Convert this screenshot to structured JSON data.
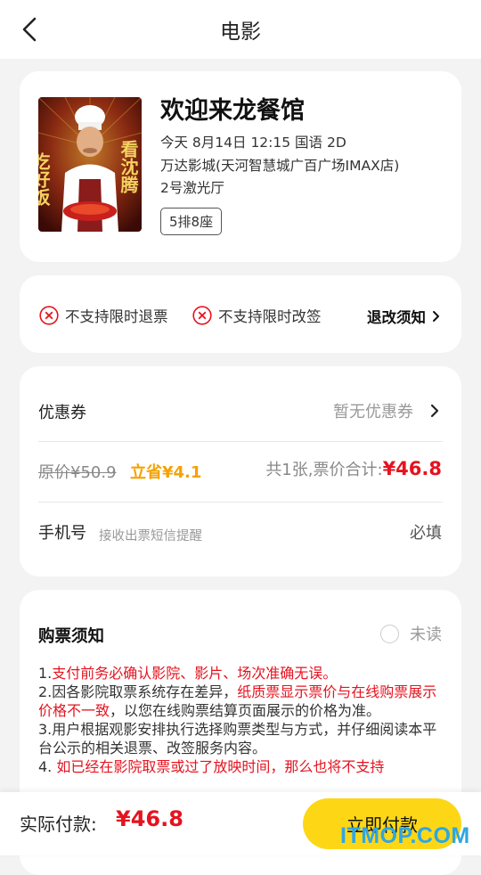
{
  "header": {
    "title": "电影"
  },
  "movie": {
    "title": "欢迎来龙餐馆",
    "showtime": "今天 8月14日 12:15 国语 2D",
    "cinema": "万达影城(天河智慧城广百广场IMAX店)",
    "hall": "2号激光厅",
    "seat": "5排8座",
    "poster_text_left": "吃好饭",
    "poster_text_right": "看沈腾"
  },
  "refund": {
    "no_refund": "不支持限时退票",
    "no_change": "不支持限时改签",
    "policy_link": "退改须知"
  },
  "payment": {
    "coupon_label": "优惠券",
    "coupon_value": "暂无优惠券",
    "original_price": "原价¥50.9",
    "saved": "立省¥4.1",
    "total_label": "共1张,票价合计:",
    "total_price": "¥46.8",
    "phone_label": "手机号",
    "phone_placeholder": "接收出票短信提醒",
    "required": "必填"
  },
  "notice": {
    "title": "购票须知",
    "unread": "未读",
    "p1_a": "1.",
    "p1_red": "支付前务必确认影院、影片、场次准确无误。",
    "p2_a": "2.因各影院取票系统存在差异，",
    "p2_red": "纸质票显示票价与在线购票展示价格不一致",
    "p2_b": "，以您在线购票结算页面展示的价格为准。",
    "p3": "3.用户根据观影安排执行选择购票类型与方式，并仔细阅读本平台公示的相关退票、改签服务内容。",
    "p4_a": "4. ",
    "p4_red": "如已经在影院取票或过了放映时间，那么也将不支持"
  },
  "bottom": {
    "actual_label": "实际付款:",
    "actual_price": "¥46.8",
    "pay_button": "立即付款"
  },
  "watermark": "ITMOP.COM",
  "colors": {
    "accent_yellow": "#fdd716",
    "price_red": "#e5131f",
    "save_orange": "#f5a200"
  }
}
